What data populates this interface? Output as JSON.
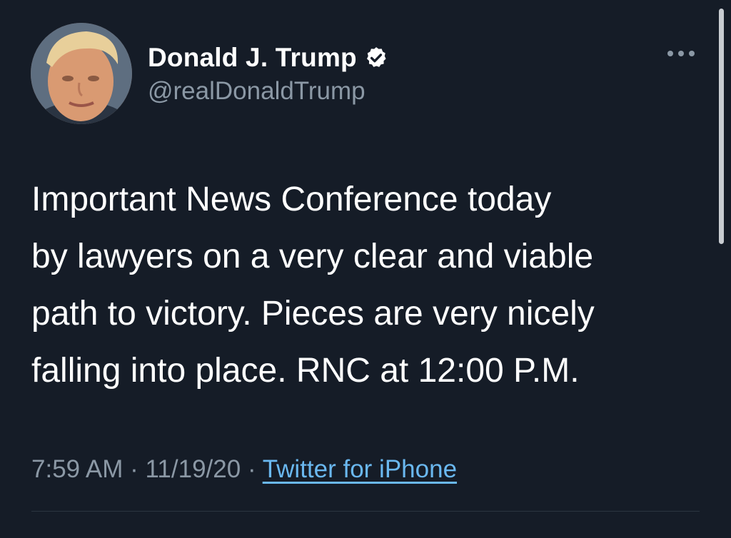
{
  "user": {
    "display_name": "Donald J. Trump",
    "handle": "@realDonaldTrump",
    "verified_icon": "verified-badge-icon"
  },
  "tweet": {
    "lines": [
      "Important News Conference today",
      "by lawyers on a very clear and viable",
      "path to victory. Pieces are very nicely",
      "falling into place. RNC at 12:00 P.M."
    ],
    "time": "7:59 AM",
    "date": "11/19/20",
    "separator": "·",
    "source": "Twitter for iPhone"
  },
  "menu": {
    "icon": "more-options-icon"
  },
  "colors": {
    "background": "#151c27",
    "text": "#ffffff",
    "secondary": "#8b98a5",
    "link": "#6ab8f0"
  }
}
